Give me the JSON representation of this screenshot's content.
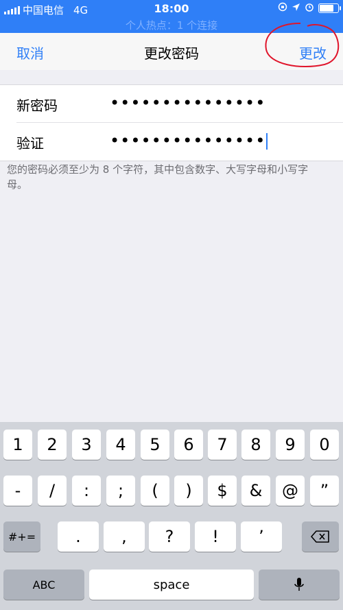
{
  "status_bar": {
    "carrier": "中国电信",
    "network": "4G",
    "time": "18:00",
    "hotspot_text": "个人热点：1 个连接"
  },
  "nav": {
    "cancel": "取消",
    "title": "更改密码",
    "done": "更改"
  },
  "form": {
    "new_password_label": "新密码",
    "new_password_value": "•••••••••••••••",
    "verify_label": "验证",
    "verify_value": "•••••••••••••••",
    "hint": "您的密码必须至少为 8 个字符，其中包含数字、大写字母和小写字母。"
  },
  "keyboard": {
    "row1": [
      "1",
      "2",
      "3",
      "4",
      "5",
      "6",
      "7",
      "8",
      "9",
      "0"
    ],
    "row2": [
      "-",
      "/",
      ":",
      ";",
      "(",
      ")",
      "$",
      "&",
      "@",
      "”"
    ],
    "row3": [
      ".",
      ",",
      "?",
      "!",
      "’"
    ],
    "symbols_key": "#+=",
    "abc_key": "ABC",
    "space_key": "space"
  },
  "colors": {
    "accent": "#2f7ff7",
    "status_bar_bg": "#2f7ff7",
    "annotation": "#e0152b"
  },
  "icons": [
    "signal-icon",
    "location-icon",
    "alarm-icon",
    "battery-icon",
    "backspace-icon",
    "microphone-icon"
  ]
}
